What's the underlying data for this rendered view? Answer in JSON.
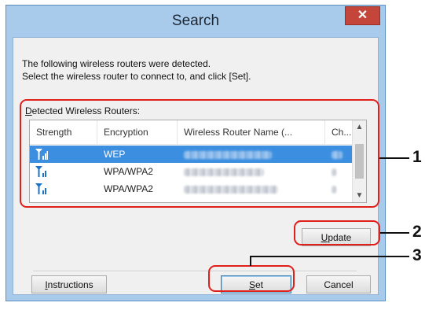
{
  "window": {
    "title": "Search",
    "close_glyph": "✕"
  },
  "intro": {
    "line1": "The following wireless routers were detected.",
    "line2": "Select the wireless router to connect to, and click [Set]."
  },
  "group_label": {
    "mnemonic": "D",
    "rest": "etected Wireless Routers:"
  },
  "table": {
    "columns": [
      "Strength",
      "Encryption",
      "Wireless Router Name (...",
      "Ch..."
    ],
    "rows": [
      {
        "strength_icon": "signal-strength-icon",
        "encryption": "WEP",
        "selected": true
      },
      {
        "strength_icon": "signal-strength-icon",
        "encryption": "WPA/WPA2",
        "selected": false
      },
      {
        "strength_icon": "signal-strength-icon",
        "encryption": "WPA/WPA2",
        "selected": false
      }
    ]
  },
  "buttons": {
    "update": {
      "mnemonic": "U",
      "rest": "pdate"
    },
    "instructions": {
      "mnemonic": "I",
      "rest": "nstructions"
    },
    "set": {
      "mnemonic": "S",
      "rest": "et"
    },
    "cancel": "Cancel"
  },
  "callouts": [
    "1",
    "2",
    "3"
  ],
  "colors": {
    "callout_border": "#e0201b",
    "selection": "#3c8fe0",
    "titlebar": "#a8cbec",
    "close_button": "#c4463b"
  }
}
